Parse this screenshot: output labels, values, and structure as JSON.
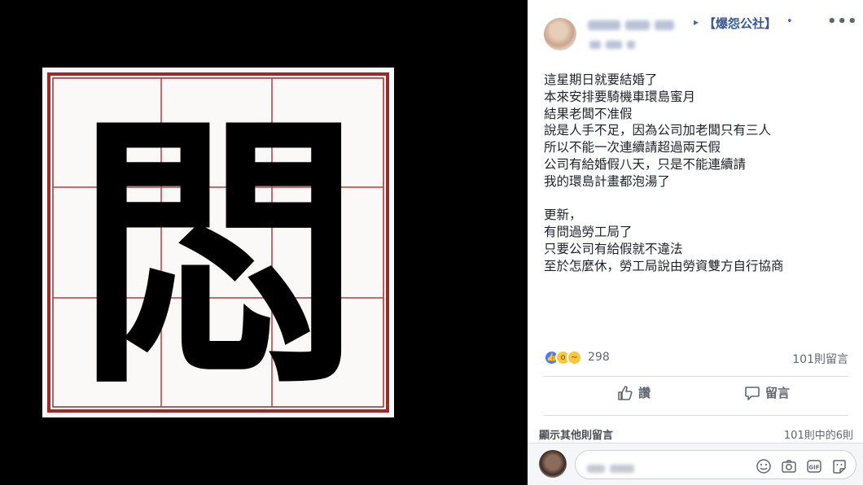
{
  "post": {
    "author_arrow": "▸",
    "group_name": "【爆怨公社】",
    "separator": "•",
    "more_icon": "•••",
    "body_lines": [
      "這星期日就要結婚了",
      "本來安排要騎機車環島蜜月",
      "結果老闆不准假",
      "說是人手不足，因為公司加老闆只有三人",
      "所以不能一次連續請超過兩天假",
      "公司有給婚假八天，只是不能連續請",
      "我的環島計畫都泡湯了",
      "",
      "更新，",
      "有問過勞工局了",
      "只要公司有給假就不違法",
      "至於怎麼休，勞工局說由勞資雙方自行協商"
    ]
  },
  "image": {
    "character": "悶",
    "icon": "calligraphy-grid-image"
  },
  "reactions": {
    "count": "298",
    "comments": "101則留言",
    "types": [
      "like-icon",
      "wow-icon",
      "sad-icon"
    ]
  },
  "actions": {
    "like_label": "讚",
    "comment_label": "留言"
  },
  "comments_bar": {
    "view_more": "顯示其他則留言",
    "pager": "101則中的6則"
  },
  "colors": {
    "link": "#365899",
    "grid_red": "#9c2a2a",
    "text": "#1d2129",
    "muted": "#606770"
  }
}
